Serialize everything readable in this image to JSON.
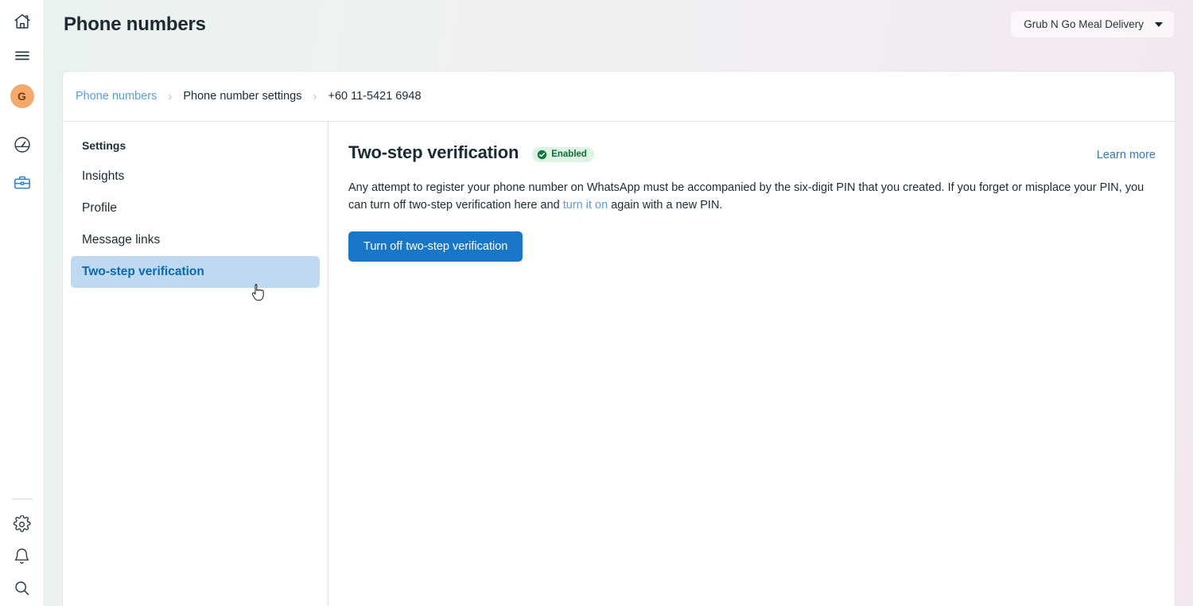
{
  "rail": {
    "icons": [
      {
        "name": "home-icon",
        "label": "Home"
      },
      {
        "name": "menu-icon",
        "label": "Menu"
      },
      {
        "name": "dashboard-icon",
        "label": "Dashboard"
      },
      {
        "name": "business-icon",
        "label": "Business"
      },
      {
        "name": "gear-icon",
        "label": "Settings"
      },
      {
        "name": "bell-icon",
        "label": "Notifications"
      },
      {
        "name": "search-icon",
        "label": "Search"
      }
    ],
    "avatar_initial": "G"
  },
  "header": {
    "title": "Phone numbers",
    "account_switcher": {
      "label": "Grub N Go Meal Delivery",
      "caret": "chevron-down-icon"
    }
  },
  "breadcrumb": {
    "items": [
      {
        "label": "Phone numbers",
        "type": "link"
      },
      {
        "label": "Phone number settings",
        "type": "text"
      },
      {
        "label": "+60 11-5421 6948",
        "type": "text"
      }
    ],
    "separator": "›"
  },
  "settings_nav": {
    "heading": "Settings",
    "items": [
      {
        "label": "Insights",
        "selected": false
      },
      {
        "label": "Profile",
        "selected": false
      },
      {
        "label": "Message links",
        "selected": false
      },
      {
        "label": "Two-step verification",
        "selected": true
      }
    ]
  },
  "content": {
    "title": "Two-step verification",
    "status_badge": {
      "label": "Enabled",
      "icon": "check-circle-icon",
      "bg_color": "#ddf3e4",
      "text_color": "#136b37"
    },
    "learn_more_label": "Learn more",
    "body": {
      "part1": "Any attempt to register your phone number on WhatsApp must be accompanied by the six-digit PIN that you created. If you forget or misplace your PIN, you can turn off two-step verification here and ",
      "link": "turn it on",
      "part2": " again with a new PIN."
    },
    "primary_button_label": "Turn off two-step verification"
  },
  "colors": {
    "accent_blue": "#1877c9",
    "link_blue": "#5b9dd9",
    "selected_nav_bg": "#bfd9f0",
    "selected_nav_text": "#0a68b6",
    "avatar_bg": "#f5a96a",
    "success_green": "#136b37"
  }
}
